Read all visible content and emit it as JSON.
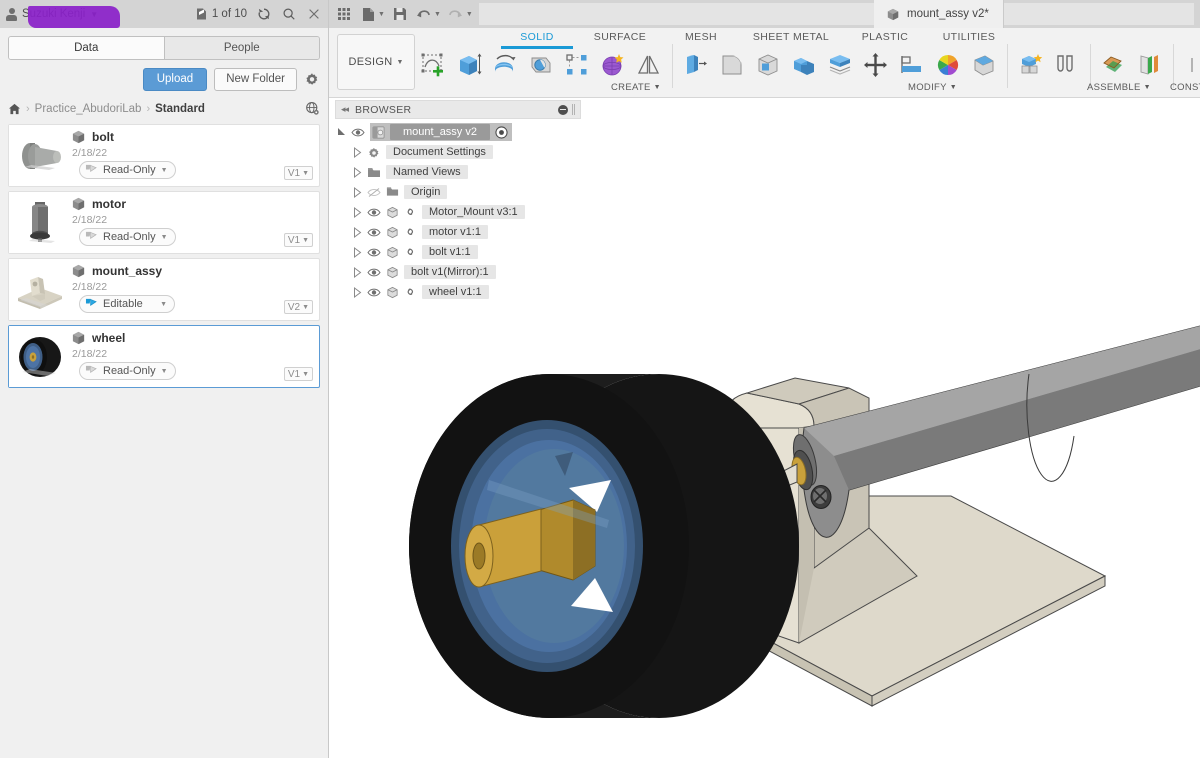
{
  "data_panel": {
    "user": {
      "name": "Suzuki Kenji",
      "caret": "▼",
      "redacted": true
    },
    "doc_count": "1 of 10",
    "icons": {
      "refresh": "refresh-icon",
      "search": "search-icon",
      "close": "close-icon"
    },
    "tabs": [
      {
        "label": "Data",
        "active": true
      },
      {
        "label": "People",
        "active": false
      }
    ],
    "actions": {
      "upload": "Upload",
      "new_folder": "New Folder",
      "settings_icon": "gear-icon"
    },
    "breadcrumb": {
      "home_icon": "home-icon",
      "separator": "›",
      "items": [
        "Practice_AbudoriLab",
        "Standard"
      ],
      "globe_icon": "globe-icon"
    },
    "files": [
      {
        "name": "bolt",
        "date": "2/18/22",
        "status": "Read-Only",
        "version": "V1",
        "editable": false,
        "selected": false,
        "thumb": "bolt-thumbnail"
      },
      {
        "name": "motor",
        "date": "2/18/22",
        "status": "Read-Only",
        "version": "V1",
        "editable": false,
        "selected": false,
        "thumb": "motor-thumbnail"
      },
      {
        "name": "mount_assy",
        "date": "2/18/22",
        "status": "Editable",
        "version": "V2",
        "editable": true,
        "selected": false,
        "thumb": "mount-assy-thumbnail"
      },
      {
        "name": "wheel",
        "date": "2/18/22",
        "status": "Read-Only",
        "version": "V1",
        "editable": false,
        "selected": true,
        "thumb": "wheel-thumbnail"
      }
    ],
    "badge_caret": "▼",
    "version_caret": "▼"
  },
  "quick_access": {
    "items": [
      {
        "icon": "grid-apps-icon",
        "caret": false
      },
      {
        "icon": "new-file-icon",
        "caret": true
      },
      {
        "icon": "save-icon",
        "caret": false
      },
      {
        "icon": "undo-icon",
        "caret": true
      },
      {
        "icon": "redo-icon",
        "caret": true
      }
    ],
    "caret_glyph": "▼"
  },
  "document_tab": {
    "title": "mount_assy v2*",
    "icon": "assembly-cube-icon"
  },
  "ribbon": {
    "workspace": {
      "label": "DESIGN",
      "caret": "▼"
    },
    "tabs": [
      {
        "label": "SOLID",
        "active": true
      },
      {
        "label": "SURFACE",
        "active": false
      },
      {
        "label": "MESH",
        "active": false
      },
      {
        "label": "SHEET METAL",
        "active": false
      },
      {
        "label": "PLASTIC",
        "active": false
      },
      {
        "label": "UTILITIES",
        "active": false
      }
    ],
    "groups": [
      {
        "label": "CREATE",
        "caret": "▼"
      },
      {
        "label": "MODIFY",
        "caret": "▼"
      },
      {
        "label": "ASSEMBLE",
        "caret": "▼"
      },
      {
        "label": "CONSTRUCT",
        "caret": "▼"
      }
    ],
    "tools": [
      "create-sketch-icon",
      "extrude-icon",
      "revolve-icon",
      "sweep-icon",
      "pattern-icon",
      "form-icon",
      "mirror-icon",
      "press-pull-icon",
      "fillet-icon",
      "shell-icon",
      "combine-icon",
      "offset-face-icon",
      "move-copy-icon",
      "align-icon",
      "appearance-icon",
      "physical-material-icon",
      "new-component-icon",
      "joint-icon",
      "offset-plane-icon",
      "midplane-icon"
    ]
  },
  "browser": {
    "title": "BROWSER",
    "collapse_icon": "collapse-arrows-icon",
    "minus_icon": "minus-circle-icon",
    "root": {
      "label": "mount_assy v2",
      "icon": "assembly-icon",
      "target_icon": "activate-target-icon",
      "visible": true
    },
    "nodes": [
      {
        "label": "Document Settings",
        "icon": "gear-icon",
        "eye": true,
        "link": false
      },
      {
        "label": "Named Views",
        "icon": "folder-icon",
        "eye": true,
        "link": false
      },
      {
        "label": "Origin",
        "icon": "folder-icon",
        "eye": false,
        "link": false
      },
      {
        "label": "Motor_Mount v3:1",
        "icon": "component-icon",
        "eye": true,
        "link": true
      },
      {
        "label": "motor v1:1",
        "icon": "component-icon",
        "eye": true,
        "link": true
      },
      {
        "label": "bolt v1:1",
        "icon": "component-icon",
        "eye": true,
        "link": true
      },
      {
        "label": "bolt v1(Mirror):1",
        "icon": "component-icon",
        "eye": true,
        "link": false
      },
      {
        "label": "wheel v1:1",
        "icon": "component-icon",
        "eye": true,
        "link": true
      }
    ]
  },
  "viewport": {
    "background": "#ffffff",
    "models": [
      {
        "name": "wheel-model",
        "colors": {
          "tire": "#1a1a1a",
          "rim": "#4a6b96",
          "hub": "#c9a13b"
        }
      },
      {
        "name": "mount-assy-model",
        "colors": {
          "base": "#ded9cb",
          "motor": "#8d8d8d",
          "cap": "#2b2b2b",
          "wire": "#b03030"
        }
      }
    ]
  },
  "colors": {
    "accent": "#1b9ad6",
    "upload_button": "#5b9bd5",
    "panel_bg": "#f0f0f0",
    "titlebar": "#d4d4d4",
    "ribbon_bg": "#f2f2f2",
    "redaction": "#8a20c9"
  }
}
